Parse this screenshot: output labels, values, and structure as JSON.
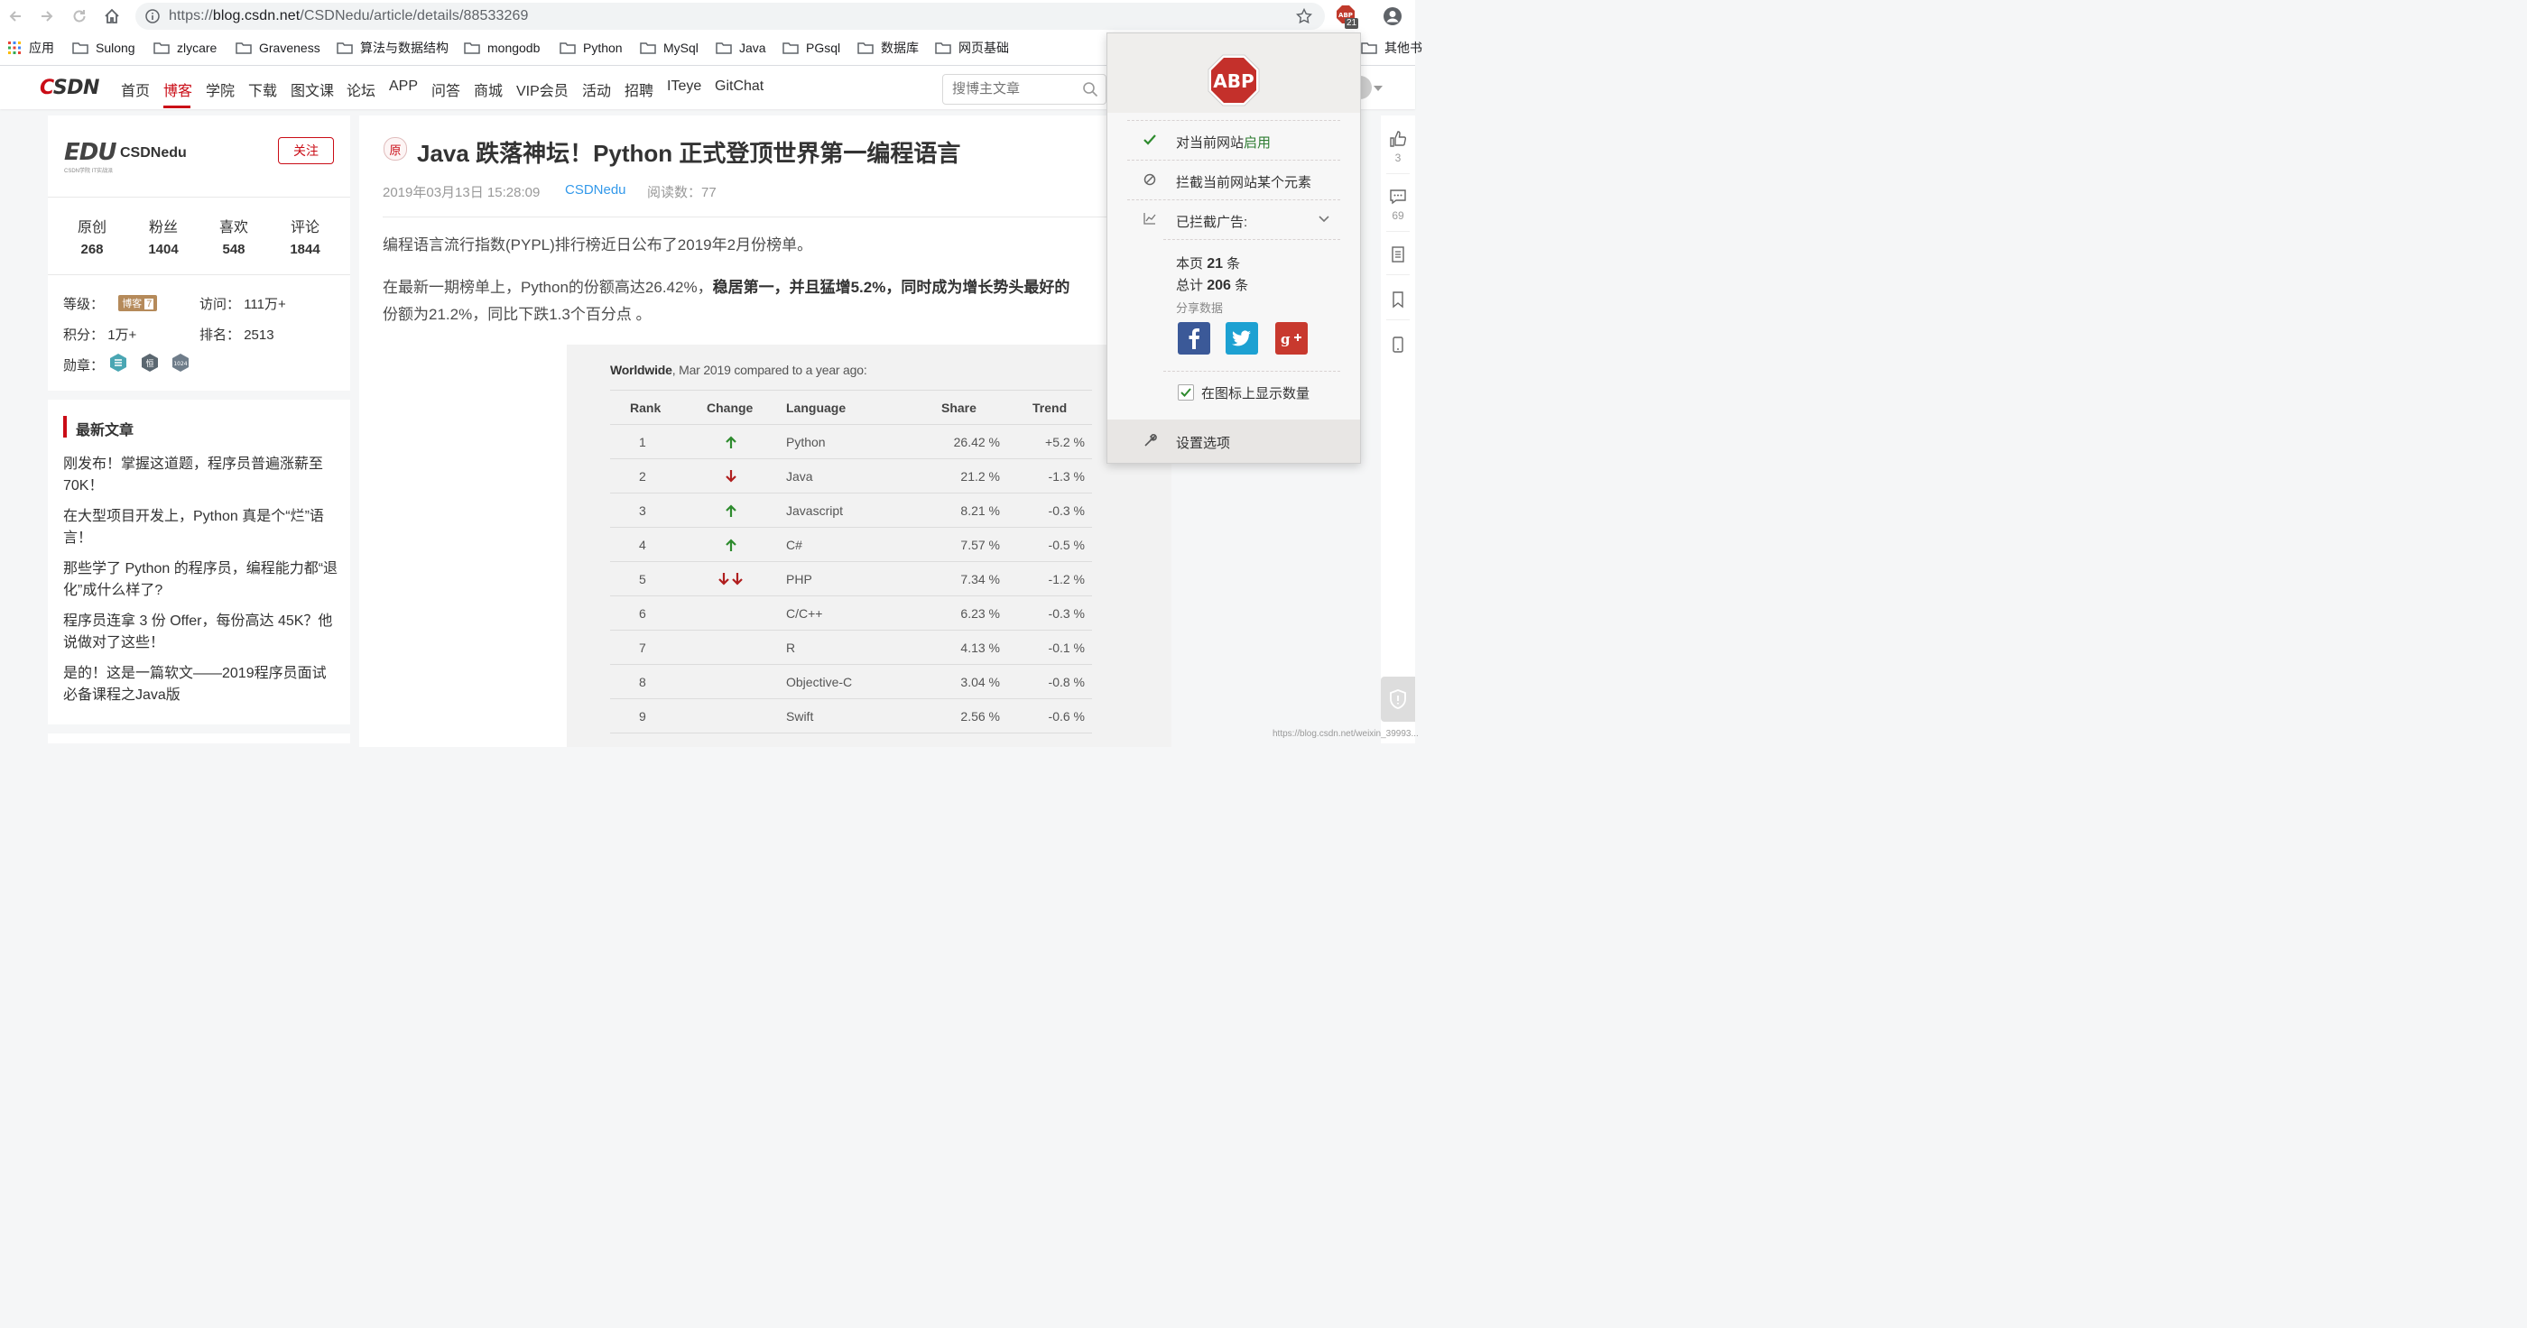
{
  "browser": {
    "url_prefix": "https://",
    "url_domain": "blog.csdn.net",
    "url_path": "/CSDNedu/article/details/88533269",
    "ext_badge": "21",
    "bookmarks": [
      "应用",
      "Sulong",
      "zlycare",
      "Graveness",
      "算法与数据结构",
      "mongodb",
      "Python",
      "MySql",
      "Java",
      "PGsql",
      "数据库",
      "网页基础",
      "其他书"
    ]
  },
  "header": {
    "logo": "CSDN",
    "nav": [
      "首页",
      "博客",
      "学院",
      "下载",
      "图文课",
      "论坛",
      "APP",
      "问答",
      "商城",
      "VIP会员",
      "活动",
      "招聘",
      "ITeye",
      "GitChat"
    ],
    "active_nav": "博客",
    "search_placeholder": "搜博主文章"
  },
  "profile": {
    "logo_text": "EDU",
    "logo_sub": "CSDN学院  IT实战派",
    "name": "CSDNedu",
    "follow_label": "关注",
    "stats": [
      {
        "label": "原创",
        "value": "268"
      },
      {
        "label": "粉丝",
        "value": "1404"
      },
      {
        "label": "喜欢",
        "value": "548"
      },
      {
        "label": "评论",
        "value": "1844"
      }
    ],
    "level_label": "等级：",
    "level_badge": "博客",
    "level_num": "7",
    "visits_label": "访问：",
    "visits_value": "111万+",
    "points_label": "积分：",
    "points_value": "1万+",
    "rank_label": "排名：",
    "rank_value": "2513",
    "medals_label": "勋章：",
    "medal_1024": "1024",
    "medal_heng": "恒"
  },
  "recent": {
    "title": "最新文章",
    "items": [
      [
        "刚发布！掌握这道题，程序员普遍涨薪至",
        "70K！"
      ],
      [
        "在大型项目开发上，Python 真是个“烂”语",
        "言！"
      ],
      [
        "那些学了 Python 的程序员，编程能力都“退",
        "化”成什么样了?"
      ],
      [
        "程序员连拿 3 份 Offer，每份高达 45K？他",
        "说做对了这些！"
      ],
      [
        "是的！这是一篇软文——2019程序员面试",
        "必备课程之Java版"
      ]
    ]
  },
  "article": {
    "badge": "原",
    "title": "Java 跌落神坛！Python 正式登顶世界第一编程语言",
    "date": "2019年03月13日 15:28:09",
    "author": "CSDNedu",
    "reads": "阅读数：77",
    "p1": "编程语言流行指数(PYPL)排行榜近日公布了2019年2月份榜单。",
    "p2_plain": "在最新一期榜单上，Python的份额高达26.42%，",
    "p2_bold": "稳居第一，并且猛增5.2%，同时成为增长势头最好的",
    "p3": "份额为21.2%，同比下跌1.3个百分点 。"
  },
  "pypl": {
    "caption_bold": "Worldwide",
    "caption_rest": ", Mar 2019 compared to a year ago:",
    "headers": [
      "Rank",
      "Change",
      "Language",
      "Share",
      "Trend"
    ],
    "rows": [
      {
        "rank": "1",
        "change": "up",
        "language": "Python",
        "share": "26.42 %",
        "trend": "+5.2 %"
      },
      {
        "rank": "2",
        "change": "down",
        "language": "Java",
        "share": "21.2 %",
        "trend": "-1.3 %"
      },
      {
        "rank": "3",
        "change": "up",
        "language": "Javascript",
        "share": "8.21 %",
        "trend": "-0.3 %"
      },
      {
        "rank": "4",
        "change": "up",
        "language": "C#",
        "share": "7.57 %",
        "trend": "-0.5 %"
      },
      {
        "rank": "5",
        "change": "down2",
        "language": "PHP",
        "share": "7.34 %",
        "trend": "-1.2 %"
      },
      {
        "rank": "6",
        "change": "",
        "language": "C/C++",
        "share": "6.23 %",
        "trend": "-0.3 %"
      },
      {
        "rank": "7",
        "change": "",
        "language": "R",
        "share": "4.13 %",
        "trend": "-0.1 %"
      },
      {
        "rank": "8",
        "change": "",
        "language": "Objective-C",
        "share": "3.04 %",
        "trend": "-0.8 %"
      },
      {
        "rank": "9",
        "change": "",
        "language": "Swift",
        "share": "2.56 %",
        "trend": "-0.6 %"
      }
    ],
    "colors": {
      "up": "#2e8b2e",
      "down": "#b01e1e"
    }
  },
  "sidebar": {
    "like_count": "3",
    "comment_count": "69"
  },
  "abp": {
    "logo": "ABP",
    "enabled_prefix": "对当前网站",
    "enabled_word": "启用",
    "block_element": "拦截当前网站某个元素",
    "blocked_label": "已拦截广告:",
    "page_prefix": "本页",
    "page_count": "21",
    "page_unit": "条",
    "total_prefix": "总计",
    "total_count": "206",
    "total_unit": "条",
    "share_label": "分享数据",
    "show_count": "在图标上显示数量",
    "settings": "设置选项"
  },
  "watermark": "https://blog.csdn.net/weixin_39993..."
}
